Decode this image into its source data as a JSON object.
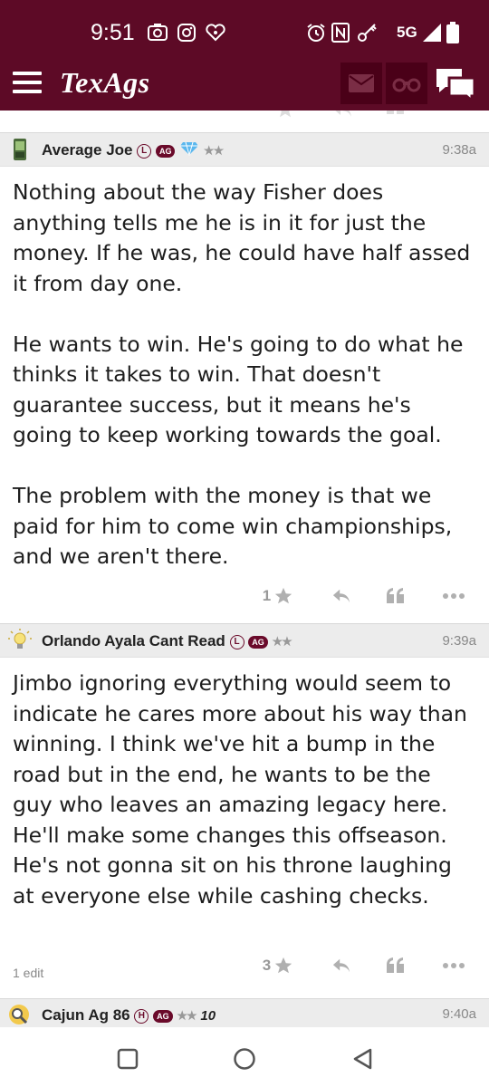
{
  "status_bar": {
    "time": "9:51",
    "network": "5G",
    "left_icons": [
      "camera-notification-icon",
      "instagram-icon",
      "iheart-icon"
    ],
    "right_icons": [
      "alarm-icon",
      "nfc-icon",
      "key-icon",
      "signal-icon",
      "battery-icon"
    ]
  },
  "app_bar": {
    "logo": "TexAgs",
    "buttons": [
      "mail-icon",
      "binoculars-icon",
      "chat-icon"
    ]
  },
  "posts": [
    {
      "username": "Average Joe",
      "badges": [
        "L",
        "AG"
      ],
      "rank": "★★",
      "time": "9:38a",
      "paragraphs": [
        "Nothing about the way Fisher does anything tells me he is in it for just the money. If he was, he could have half assed it from day one.",
        "He wants to win. He's going to do what he thinks it takes to win. That doesn't guarantee success, but it means he's going to keep working towards the goal.",
        "The problem with the money is that we paid for him to come win championships, and we aren't there."
      ],
      "star_count": "1",
      "edit_note": ""
    },
    {
      "username": "Orlando Ayala Cant Read",
      "badges": [
        "L",
        "AG"
      ],
      "rank": "★★",
      "time": "9:39a",
      "paragraphs": [
        "Jimbo ignoring everything would seem to indicate he cares more about his way than winning. I think we've hit a bump in the road but in the end, he wants to be the guy who leaves an amazing legacy here. He'll make some changes this offseason. He's not gonna sit on his throne laughing at everyone else while cashing checks."
      ],
      "star_count": "3",
      "edit_note": "1 edit"
    },
    {
      "username": "Cajun Ag 86",
      "badges": [
        "H",
        "AG"
      ],
      "rank": "★★",
      "extra_badge": "10",
      "time": "9:40a"
    }
  ],
  "colors": {
    "brand": "#5d0a26",
    "header_bg": "#ececec",
    "muted_icon": "#aaaaaa"
  },
  "nav_bar": {
    "buttons": [
      "recents-icon",
      "home-icon",
      "back-icon"
    ]
  }
}
